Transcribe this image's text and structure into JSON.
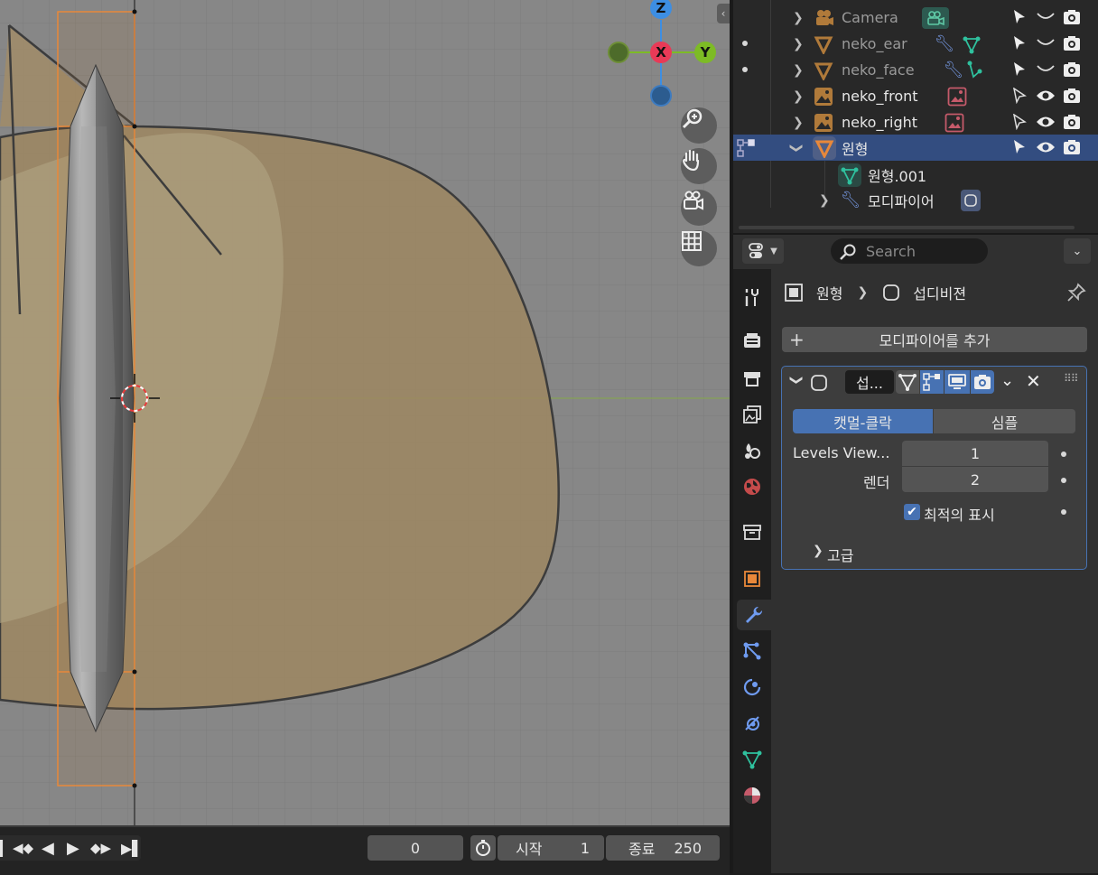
{
  "viewport": {
    "gizmo": {
      "z": "Z",
      "x": "X",
      "y": "Y"
    },
    "nav_icons": [
      "zoom-icon",
      "hand-icon",
      "camera-icon",
      "grid-icon"
    ]
  },
  "timeline": {
    "current_frame": "0",
    "start_label": "시작",
    "start_value": "1",
    "end_label": "종료",
    "end_value": "250"
  },
  "outliner": {
    "rows": [
      {
        "label": "Camera"
      },
      {
        "label": "neko_ear"
      },
      {
        "label": "neko_face"
      },
      {
        "label": "neko_front"
      },
      {
        "label": "neko_right"
      },
      {
        "label": "원형"
      },
      {
        "label": "원형.001"
      },
      {
        "label": "모디파이어"
      }
    ]
  },
  "properties": {
    "search_placeholder": "Search",
    "breadcrumb": {
      "object": "원형",
      "modifier": "섭디비젼"
    },
    "add_modifier_label": "모디파이어를 추가",
    "modifier": {
      "name": "섭...",
      "tab_active": "캣멀-클락",
      "tab_other": "심플",
      "levels_label": "Levels View...",
      "levels_value": "1",
      "render_label": "렌더",
      "render_value": "2",
      "optimal_label": "최적의 표시",
      "optimal_checked": true,
      "advanced_label": "고급"
    }
  },
  "colors": {
    "accent": "#4772b3",
    "selected_row": "#334d80",
    "orange": "#e8883a",
    "mesh_green": "#2fc19e",
    "axis_x": "#e83a57",
    "axis_y": "#7dbb25",
    "axis_z": "#3d8ee3"
  }
}
